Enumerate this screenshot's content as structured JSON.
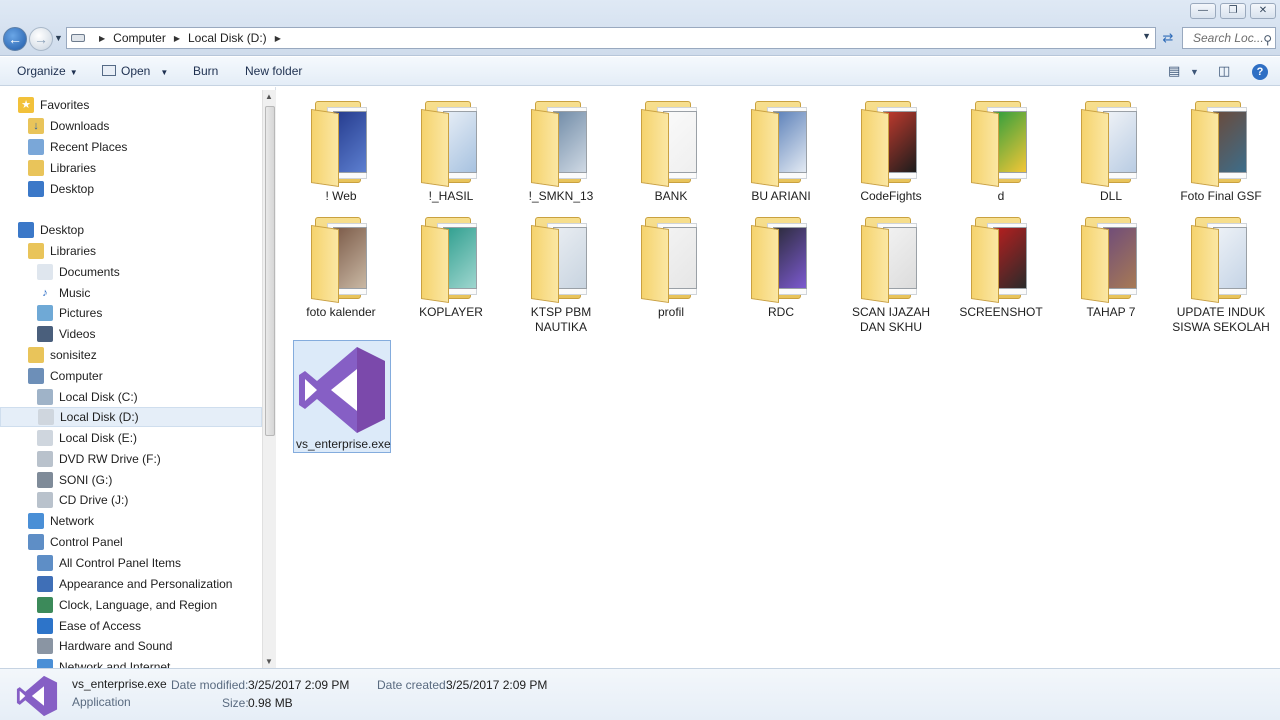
{
  "window": {
    "controls": {
      "minimize": "—",
      "maximize": "❐",
      "close": "✕"
    }
  },
  "address_bar": {
    "crumbs": [
      "Computer",
      "Local Disk (D:)"
    ],
    "search_placeholder": "Search Loc..."
  },
  "toolbar": {
    "organize": "Organize",
    "open": "Open",
    "burn": "Burn",
    "new_folder": "New folder"
  },
  "nav": {
    "items": [
      {
        "label": "Favorites",
        "icon": "star-icon",
        "level": 0
      },
      {
        "label": "Downloads",
        "icon": "downloads-folder-icon",
        "level": 1
      },
      {
        "label": "Recent Places",
        "icon": "recent-places-icon",
        "level": 1
      },
      {
        "label": "Libraries",
        "icon": "libraries-icon",
        "level": 1
      },
      {
        "label": "Desktop",
        "icon": "desktop-icon",
        "level": 1
      },
      {
        "label": "Desktop",
        "icon": "desktop-icon",
        "level": 0
      },
      {
        "label": "Libraries",
        "icon": "libraries-icon",
        "level": 1
      },
      {
        "label": "Documents",
        "icon": "documents-icon",
        "level": 2
      },
      {
        "label": "Music",
        "icon": "music-icon",
        "level": 2
      },
      {
        "label": "Pictures",
        "icon": "pictures-icon",
        "level": 2
      },
      {
        "label": "Videos",
        "icon": "videos-icon",
        "level": 2
      },
      {
        "label": "sonisitez",
        "icon": "user-folder-icon",
        "level": 1
      },
      {
        "label": "Computer",
        "icon": "computer-icon",
        "level": 1
      },
      {
        "label": "Local Disk (C:)",
        "icon": "system-drive-icon",
        "level": 2
      },
      {
        "label": "Local Disk (D:)",
        "icon": "drive-icon",
        "level": 2,
        "selected": true
      },
      {
        "label": "Local Disk (E:)",
        "icon": "drive-icon",
        "level": 2
      },
      {
        "label": "DVD RW Drive (F:)",
        "icon": "dvd-drive-icon",
        "level": 2
      },
      {
        "label": "SONI (G:)",
        "icon": "usb-drive-icon",
        "level": 2
      },
      {
        "label": "CD Drive (J:)",
        "icon": "cd-drive-icon",
        "level": 2
      },
      {
        "label": "Network",
        "icon": "network-icon",
        "level": 1
      },
      {
        "label": "Control Panel",
        "icon": "control-panel-icon",
        "level": 1
      },
      {
        "label": "All Control Panel Items",
        "icon": "control-panel-icon",
        "level": 2
      },
      {
        "label": "Appearance and Personalization",
        "icon": "appearance-icon",
        "level": 2
      },
      {
        "label": "Clock, Language, and Region",
        "icon": "clock-icon",
        "level": 2
      },
      {
        "label": "Ease of Access",
        "icon": "ease-of-access-icon",
        "level": 2
      },
      {
        "label": "Hardware and Sound",
        "icon": "hardware-sound-icon",
        "level": 2
      },
      {
        "label": "Network and Internet",
        "icon": "network-internet-icon",
        "level": 2
      }
    ]
  },
  "files": {
    "row1": [
      "! Web",
      "!_HASIL",
      "!_SMKN_13",
      "BANK",
      "BU ARIANI",
      "CodeFights",
      "d",
      "DLL",
      "Foto Final GSF"
    ],
    "row2": [
      [
        "foto kalender",
        ""
      ],
      [
        "KOPLAYER",
        ""
      ],
      [
        "KTSP PBM",
        "NAUTIKA"
      ],
      [
        "profil",
        ""
      ],
      [
        "RDC",
        ""
      ],
      [
        "SCAN IJAZAH",
        "DAN SKHU"
      ],
      [
        "SCREENSHOT",
        ""
      ],
      [
        "TAHAP 7",
        ""
      ],
      [
        "UPDATE INDUK",
        "SISWA SEKOLAH"
      ]
    ],
    "selected_file": "vs_enterprise.exe"
  },
  "details": {
    "name": "vs_enterprise.exe",
    "type": "Application",
    "date_modified_label": "Date modified:",
    "date_modified": "3/25/2017 2:09 PM",
    "date_created_label": "Date created:",
    "date_created": "3/25/2017 2:09 PM",
    "size_label": "Size:",
    "size": "0.98 MB"
  },
  "colors": {
    "vs_purple": "#865fc5",
    "vs_purple_dark": "#68217a",
    "folder_yellow": "#f5d36e",
    "selection": "#dceaf9"
  }
}
